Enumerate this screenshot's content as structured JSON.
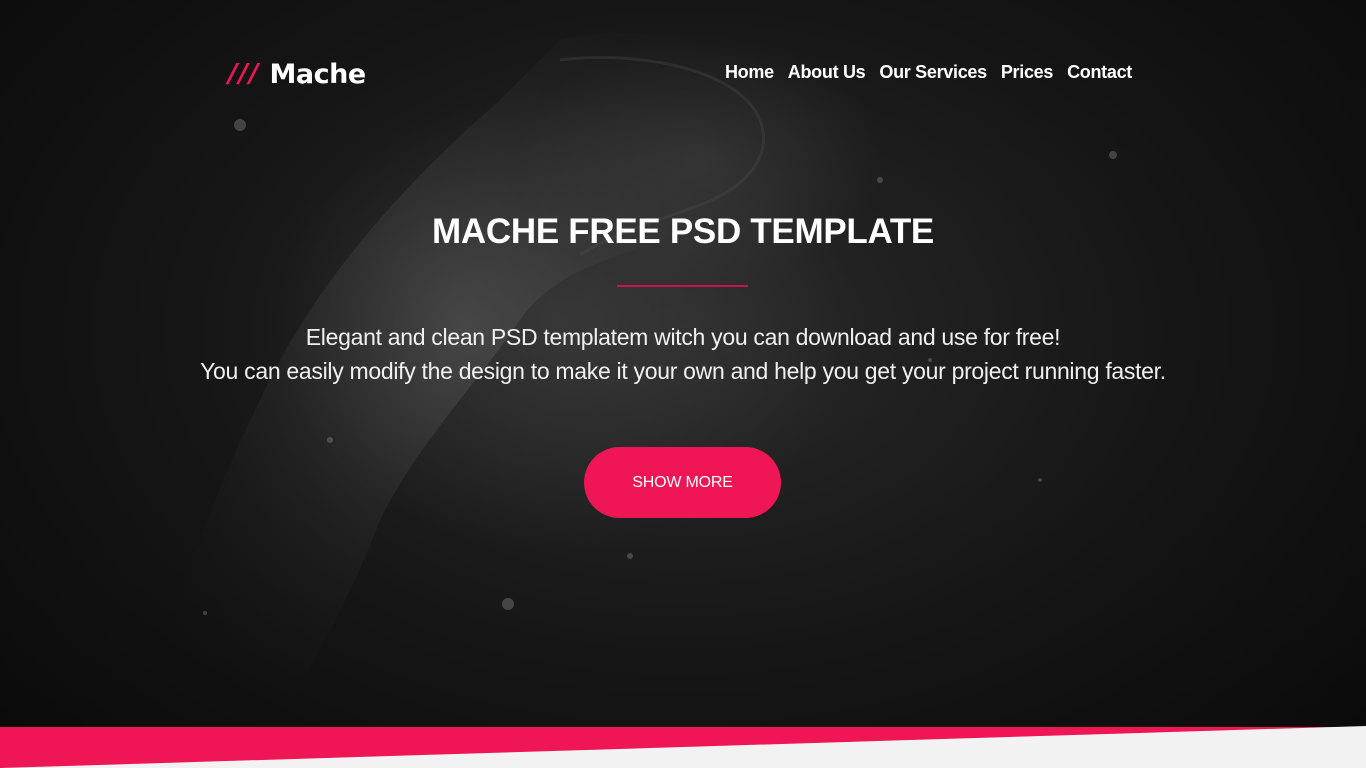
{
  "logo": {
    "mark": "///",
    "name": "Mache"
  },
  "nav": {
    "items": [
      {
        "label": "Home"
      },
      {
        "label": "About Us"
      },
      {
        "label": "Our Services"
      },
      {
        "label": "Prices"
      },
      {
        "label": "Contact"
      }
    ]
  },
  "hero": {
    "title_strong": "MACHE",
    "title_rest": " FREE PSD TEMPLATE",
    "description_line1": "Elegant and clean PSD templatem witch you can download and use for free!",
    "description_line2": "You can easily modify the design to make it your own and help you get your project running faster.",
    "cta_label": "SHOW MORE"
  },
  "colors": {
    "accent": "#ee1655",
    "background": "#161616",
    "band_light": "#f2f2f2"
  }
}
